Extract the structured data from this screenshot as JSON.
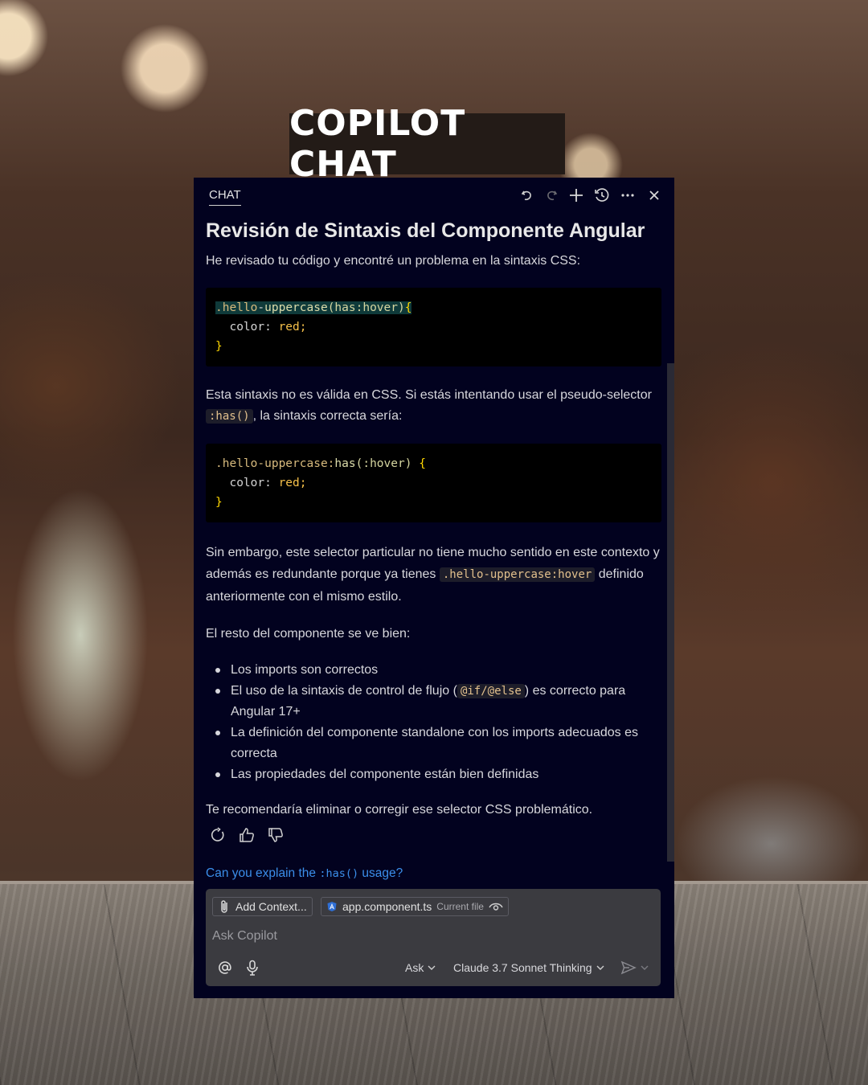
{
  "banner": {
    "title": "COPILOT CHAT"
  },
  "header": {
    "tab_label": "CHAT",
    "icons": [
      "undo-icon",
      "redo-icon",
      "plus-icon",
      "history-icon",
      "more-icon",
      "close-icon"
    ]
  },
  "message": {
    "title": "Revisión de Sintaxis del Componente Angular",
    "intro": "He revisado tu código y encontré un problema en la sintaxis CSS:",
    "code1": {
      "line1_selector": ".hello",
      "line1_dash": "-",
      "line1_fn": "uppercase",
      "line1_args": "(has:hover)",
      "line1_brace": "{",
      "line2_prop": "  color: ",
      "line2_val": "red;",
      "line3_brace": "}"
    },
    "para2_a": "Esta sintaxis no es válida en CSS. Si estás intentando usar el pseudo-selector ",
    "para2_code": ":has()",
    "para2_b": ", la sintaxis correcta sería:",
    "code2": {
      "line1_selector": ".hello-uppercase:",
      "line1_fn": "has",
      "line1_args": "(:hover) ",
      "line1_brace": "{",
      "line2_prop": "  color: ",
      "line2_val": "red;",
      "line3_brace": "}"
    },
    "para3_a": "Sin embargo, este selector particular no tiene mucho sentido en este contexto y además es redundante porque ya tienes ",
    "para3_code": ".hello-uppercase:hover",
    "para3_b": " definido anteriormente con el mismo estilo.",
    "para4": "El resto del componente se ve bien:",
    "bullets": {
      "b1": "Los imports son correctos",
      "b2_a": "El uso de la sintaxis de control de flujo (",
      "b2_code": "@if/@else",
      "b2_b": ") es correcto para Angular 17+",
      "b3": "La definición del componente standalone con los imports adecuados es correcta",
      "b4": "Las propiedades del componente están bien definidas"
    },
    "closing": "Te recomendaría eliminar o corregir ese selector CSS problemático."
  },
  "feedback_icons": [
    "retry-icon",
    "thumbs-up-icon",
    "thumbs-down-icon"
  ],
  "suggestion": {
    "text_a": "Can you explain the ",
    "code": ":has()",
    "text_b": " usage?"
  },
  "input": {
    "add_context_label": "Add Context...",
    "file_name": "app.component.ts",
    "file_tag": "Current file",
    "placeholder": "Ask Copilot",
    "mode_label": "Ask",
    "model_label": "Claude 3.7 Sonnet Thinking"
  },
  "colors": {
    "panel_bg": "#02021f",
    "link": "#3b8eea",
    "code_value": "#f5c04a"
  }
}
